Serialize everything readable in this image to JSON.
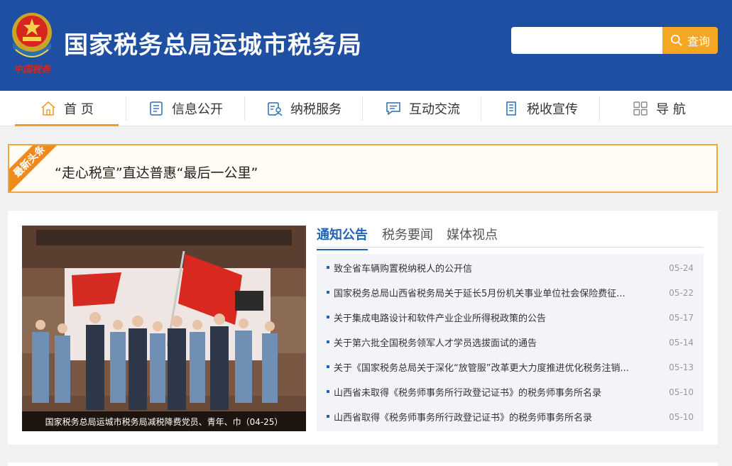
{
  "header": {
    "title": "国家税务总局运城市税务局",
    "emblem_text": "中国税务",
    "search": {
      "placeholder": "",
      "button_label": "查询"
    },
    "colors": {
      "bg": "#1f4fa2",
      "search_button": "#f5a623"
    }
  },
  "nav": {
    "items": [
      {
        "label": "首 页",
        "icon": "home-icon",
        "active": true
      },
      {
        "label": "信息公开",
        "icon": "document-list-icon",
        "active": false
      },
      {
        "label": "纳税服务",
        "icon": "user-service-icon",
        "active": false
      },
      {
        "label": "互动交流",
        "icon": "chat-icon",
        "active": false
      },
      {
        "label": "税收宣传",
        "icon": "book-icon",
        "active": false
      },
      {
        "label": "导 航",
        "icon": "grid-icon",
        "active": false
      }
    ],
    "accent": "#f39a2b"
  },
  "headline": {
    "badge": "最新头条",
    "text": "“走心税宣”直达普惠“最后一公里”"
  },
  "feature": {
    "caption": "国家税务总局运城市税务局减税降费党员、青年、巾（04-25）"
  },
  "news": {
    "tabs": [
      {
        "label": "通知公告",
        "active": true
      },
      {
        "label": "税务要闻",
        "active": false
      },
      {
        "label": "媒体视点",
        "active": false
      }
    ],
    "items": [
      {
        "title": "致全省车辆购置税纳税人的公开信",
        "date": "05-24"
      },
      {
        "title": "国家税务总局山西省税务局关于延长5月份机关事业单位社会保险费征...",
        "date": "05-22"
      },
      {
        "title": "关于集成电路设计和软件产业企业所得税政策的公告",
        "date": "05-17"
      },
      {
        "title": "关于第六批全国税务领军人才学员选拔面试的通告",
        "date": "05-14"
      },
      {
        "title": "关于《国家税务总局关于深化“放管服”改革更大力度推进优化税务注销...",
        "date": "05-13"
      },
      {
        "title": "山西省未取得《税务师事务所行政登记证书》的税务师事务所名录",
        "date": "05-10"
      },
      {
        "title": "山西省取得《税务师事务所行政登记证书》的税务师事务所名录",
        "date": "05-10"
      }
    ],
    "accent": "#1f64b8"
  }
}
